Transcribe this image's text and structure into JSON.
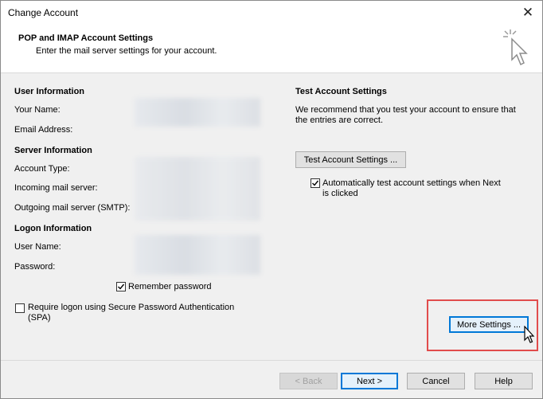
{
  "window": {
    "title": "Change Account",
    "close_glyph": "✕"
  },
  "header": {
    "title": "POP and IMAP Account Settings",
    "subtitle": "Enter the mail server settings for your account."
  },
  "user_info": {
    "section": "User Information",
    "your_name_label": "Your Name:",
    "email_label": "Email Address:"
  },
  "server_info": {
    "section": "Server Information",
    "account_type_label": "Account Type:",
    "incoming_label": "Incoming mail server:",
    "outgoing_label": "Outgoing mail server (SMTP):"
  },
  "logon_info": {
    "section": "Logon Information",
    "user_name_label": "User Name:",
    "password_label": "Password:",
    "remember_password_label": "Remember password",
    "remember_password_checked": true,
    "spa_label_line1": "Require logon using Secure Password Authentication",
    "spa_label_line2": "(SPA)",
    "spa_checked": false
  },
  "test_settings": {
    "section": "Test Account Settings",
    "desc_line1": "We recommend that you test your account to ensure that",
    "desc_line2": "the entries are correct.",
    "test_button": "Test Account Settings ...",
    "auto_test_line1": "Automatically test account settings when Next",
    "auto_test_line2": "is clicked",
    "auto_test_checked": true
  },
  "more_settings_button": "More Settings ...",
  "footer": {
    "back": "< Back",
    "next": "Next >",
    "cancel": "Cancel",
    "help": "Help"
  },
  "colors": {
    "highlight": "#e14c4c",
    "focus": "#0078d7"
  }
}
